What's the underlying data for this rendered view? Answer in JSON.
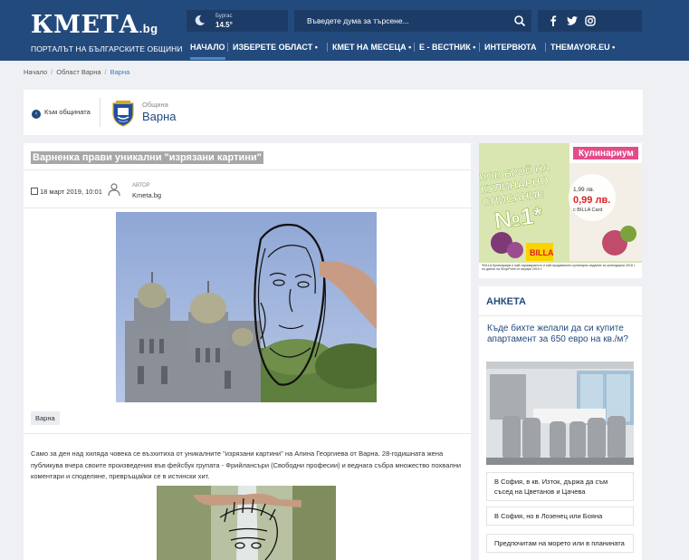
{
  "header": {
    "logo": "КМЕТА",
    "logo_domain": ".bg",
    "tagline": "ПОРТАЛЪТ НА БЪЛГАРСКИТЕ ОБЩИНИ",
    "weather": {
      "city": "Бургас",
      "temp": "14.5°"
    },
    "search_placeholder": "Въведете дума за търсене...",
    "social": [
      "facebook-icon",
      "twitter-icon",
      "instagram-icon"
    ]
  },
  "nav": {
    "items": [
      {
        "label": "НАЧАЛО"
      },
      {
        "label": "ИЗБЕРЕТЕ ОБЛАСТ •"
      },
      {
        "label": "КМЕТ НА МЕСЕЦА •"
      },
      {
        "label": "Е - ВЕСТНИК •"
      },
      {
        "label": "ИНТЕРВЮТА"
      },
      {
        "label": "THEMAYOR.EU •"
      }
    ]
  },
  "breadcrumb": {
    "home": "Начало",
    "region": "Област Варна",
    "current": "Варна"
  },
  "municipality": {
    "back_label": "Към общината",
    "label": "Община",
    "name": "Варна"
  },
  "article": {
    "title": "Варненка прави уникални \"изрязани картини\"",
    "date": "18 март 2019, 10:01",
    "author_label": "АВТОР",
    "author": "Kmeta.bg",
    "tag": "Варна",
    "paragraph": "Само за ден над хиляда човека се възхитиха от уникалните \"изрязани картини\" на Алина Георгиева от Варна. 28-годишната жена публикува вчера своите произведения във фейсбук групата - Фрийлансъри (Свободни професии) и веднага събра множество похвални коментари и споделяне, превръщайки се в истински хит."
  },
  "ad": {
    "line1": "НОВ БРОЙ НА",
    "line2": "КУЛИНАРНО",
    "line3": "СПИСАНИЕ",
    "big": "№1*",
    "magazine": "Кулинариум",
    "price_old": "1,99 лв.",
    "price_new": "0,99 лв.",
    "price_note": "с BILLA Card",
    "brand": "BILLA",
    "footer": "*BILLA Кулинариум е най-тиражираното и най-продаваното кулинарно издание за календарна 2018 г. по данни на ShopPoint от януари 2019 г."
  },
  "poll": {
    "heading": "АНКЕТА",
    "question": "Къде бихте желали да си купите апартамент за 650 евро на кв./м?",
    "options": [
      "В София, в кв. Изток, държа да съм съсед на Цветанов и Цачева",
      "В София, но в Лозенец или Бояна",
      "Предпочитам на морето или в планината"
    ]
  }
}
